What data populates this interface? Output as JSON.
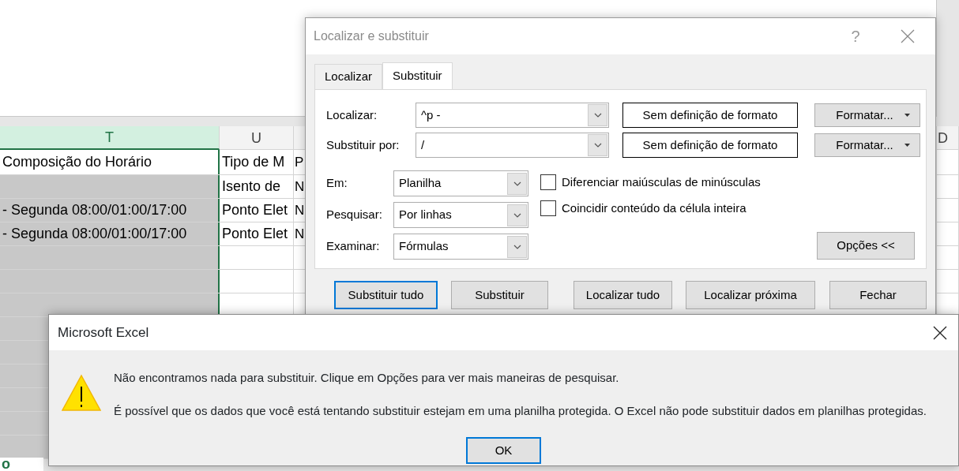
{
  "spreadsheet": {
    "columns": [
      {
        "label": "T",
        "selected": true
      },
      {
        "label": "U",
        "selected": false
      },
      {
        "label": "D",
        "selected": false
      }
    ],
    "rows": [
      {
        "t": "Composição do Horário",
        "u": "Tipo de M",
        "column_3": "P",
        "shaded": false
      },
      {
        "u": "Isento de",
        "column_3": "N",
        "shaded": true
      },
      {
        "t": "- Segunda 08:00/01:00/17:00",
        "u": "Ponto Elet",
        "column_3": "N",
        "shaded": true
      },
      {
        "t": "- Segunda 08:00/01:00/17:00",
        "u": "Ponto Elet",
        "column_3": "N",
        "shaded": true
      },
      {
        "shaded": true
      },
      {
        "shaded": true
      },
      {
        "shaded": true
      },
      {
        "shaded": true
      },
      {
        "shaded": true
      },
      {
        "shaded": true
      },
      {
        "shaded": true
      },
      {
        "shaded": true
      },
      {
        "shaded": true
      }
    ],
    "sheet_tab": "o"
  },
  "find_replace_dialog": {
    "title": "Localizar e substituir",
    "help_button": "?",
    "tabs": [
      {
        "label": "Localizar",
        "selected": false
      },
      {
        "label": "Substituir",
        "selected": true
      }
    ],
    "fields": [
      {
        "label": "Localizar:",
        "value": "^p -",
        "format": "Sem definição de formato",
        "format_button": "Formatar..."
      },
      {
        "label": "Substituir por:",
        "value": "/",
        "format": "Sem definição de formato",
        "format_button": "Formatar..."
      }
    ],
    "options": [
      {
        "label": "Em:",
        "value": "Planilha"
      },
      {
        "label": "Pesquisar:",
        "value": "Por linhas"
      },
      {
        "label": "Examinar:",
        "value": "Fórmulas"
      }
    ],
    "checkboxes": [
      {
        "label": "Diferenciar maiúsculas de minúsculas",
        "checked": false
      },
      {
        "label": "Coincidir conteúdo da célula inteira",
        "checked": false
      }
    ],
    "options_button": "Opções <<",
    "buttons": [
      {
        "label": "Substituir tudo",
        "focused": true
      },
      {
        "label": "Substituir",
        "focused": false
      },
      {
        "label": "Localizar tudo",
        "focused": false
      },
      {
        "label": "Localizar próxima",
        "focused": false
      },
      {
        "label": "Fechar",
        "focused": false
      }
    ]
  },
  "message_box": {
    "title": "Microsoft Excel",
    "messages": [
      "Não encontramos nada para substituir. Clique em Opções para ver mais maneiras de pesquisar.",
      "É possível que os dados que você está tentando substituir estejam em uma planilha protegida. O Excel não pode substituir dados em planilhas protegidas."
    ],
    "button": {
      "label": "OK",
      "focused": true
    }
  }
}
